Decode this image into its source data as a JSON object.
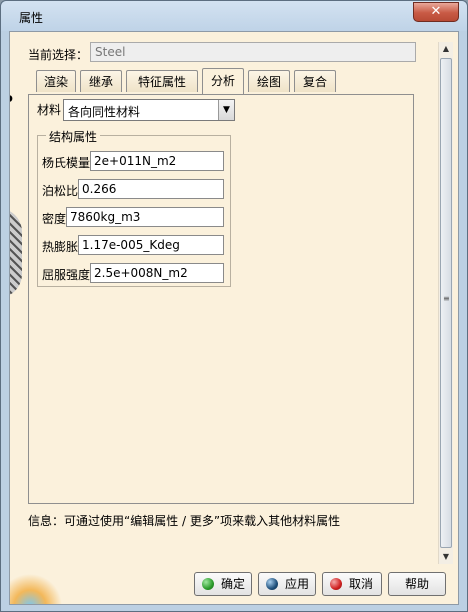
{
  "window": {
    "title": "属性",
    "close_glyph": "✕"
  },
  "current_selection": {
    "label": "当前选择：",
    "value": "Steel"
  },
  "tabs": [
    {
      "label": "渲染"
    },
    {
      "label": "继承"
    },
    {
      "label": "特征属性"
    },
    {
      "label": "分析",
      "active": true
    },
    {
      "label": "绘图"
    },
    {
      "label": "复合"
    }
  ],
  "analysis": {
    "material_label": "材料",
    "material_value": "各向同性材料",
    "group_title": "结构属性",
    "properties": [
      {
        "label": "杨氏模量",
        "value": "2e+011N_m2"
      },
      {
        "label": "泊松比",
        "value": "0.266"
      },
      {
        "label": "密度",
        "value": "7860kg_m3"
      },
      {
        "label": "热膨胀",
        "value": "1.17e-005_Kdeg"
      },
      {
        "label": "屈服强度",
        "value": "2.5e+008N_m2"
      }
    ]
  },
  "info_text": "信息：可通过使用“编辑属性 / 更多”项来载入其他材料属性",
  "buttons": {
    "ok": "确定",
    "apply": "应用",
    "cancel": "取消",
    "help": "帮助"
  },
  "colors": {
    "ok_icon": "#2a9a2a",
    "apply_icon": "#1e4f7a",
    "cancel_icon": "#d02020"
  },
  "icons": {
    "combo_arrow": "▼",
    "scroll_up": "▲",
    "scroll_down": "▼",
    "scroll_grip": "≡"
  }
}
